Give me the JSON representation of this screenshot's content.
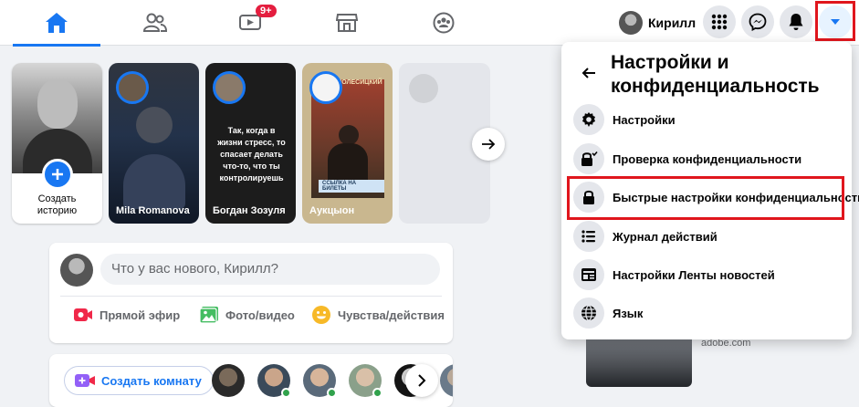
{
  "nav": {
    "tabs": [
      {
        "name": "home",
        "icon": "home-icon",
        "active": true
      },
      {
        "name": "friends",
        "icon": "friends-icon",
        "active": false
      },
      {
        "name": "watch",
        "icon": "video-icon",
        "badge": "9+"
      },
      {
        "name": "marketplace",
        "icon": "store-icon",
        "active": false
      },
      {
        "name": "groups",
        "icon": "groups-icon",
        "active": false
      }
    ],
    "profile_name": "Кирилл",
    "icons": [
      "menu-grid-icon",
      "messenger-icon",
      "bell-icon",
      "caret-down-icon"
    ]
  },
  "stories": {
    "create_label": "Создать историю",
    "items": [
      {
        "name": "Mila Romanova"
      },
      {
        "name": "Богдан Зозуля",
        "text": "Так, когда в жизни стресс, то спасает делать что-то, что ты контролируешь"
      },
      {
        "name": "Аукцыон",
        "poster_top": "ИГОРЬ ПОЛЕСИЦКИЙ",
        "poster_bottom": "ССЫЛКА НА БИЛЕТЫ"
      }
    ]
  },
  "composer": {
    "placeholder": "Что у вас нового, Кирилл?",
    "actions": [
      {
        "label": "Прямой эфир",
        "icon": "live-video-icon"
      },
      {
        "label": "Фото/видео",
        "icon": "photo-icon"
      },
      {
        "label": "Чувства/действия",
        "icon": "smile-icon"
      }
    ]
  },
  "rooms": {
    "create_label": "Создать комнату"
  },
  "ad": {
    "domain": "adobe.com"
  },
  "menu": {
    "title": "Настройки и конфиденциальность",
    "items": [
      {
        "label": "Настройки",
        "icon": "gear-icon"
      },
      {
        "label": "Проверка конфиденциальности",
        "icon": "lock-check-icon"
      },
      {
        "label": "Быстрые настройки конфиденциальности",
        "icon": "lock-icon",
        "highlighted": true
      },
      {
        "label": "Журнал действий",
        "icon": "list-icon"
      },
      {
        "label": "Настройки Ленты новостей",
        "icon": "news-feed-icon"
      },
      {
        "label": "Язык",
        "icon": "globe-icon"
      }
    ]
  },
  "colors": {
    "accent": "#1877f2",
    "highlight_frame": "#e0161d",
    "badge": "#e41e3f"
  }
}
